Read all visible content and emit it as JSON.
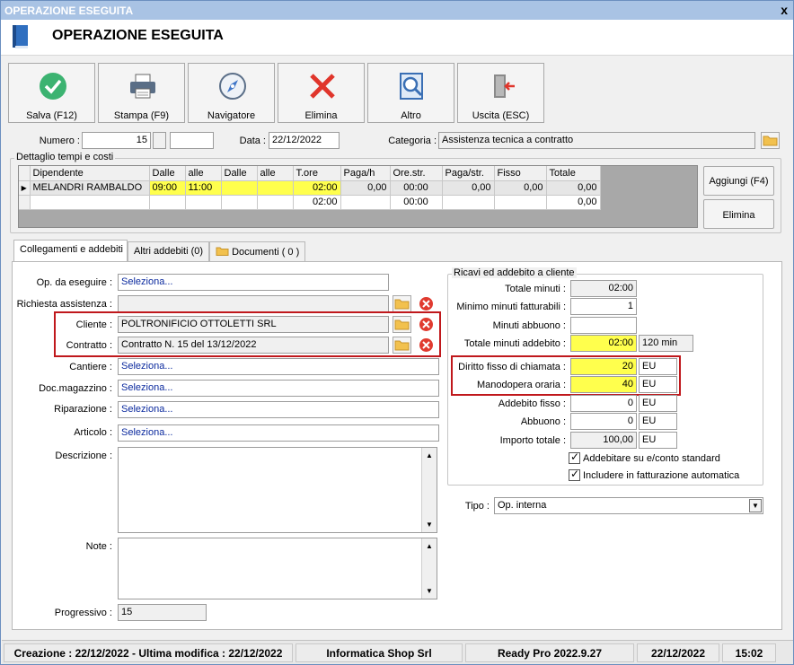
{
  "window": {
    "title": "OPERAZIONE ESEGUITA",
    "close": "x",
    "header_title": "OPERAZIONE ESEGUITA"
  },
  "toolbar": [
    {
      "label": "Salva (F12)",
      "icon": "check-icon"
    },
    {
      "label": "Stampa (F9)",
      "icon": "printer-icon"
    },
    {
      "label": "Navigatore",
      "icon": "compass-icon"
    },
    {
      "label": "Elimina",
      "icon": "delete-x-icon"
    },
    {
      "label": "Altro",
      "icon": "search-doc-icon"
    },
    {
      "label": "Uscita (ESC)",
      "icon": "exit-door-icon"
    }
  ],
  "top": {
    "numero_label": "Numero :",
    "numero_value": "15",
    "numero_suffix": "",
    "data_label": "Data :",
    "data_value": "22/12/2022",
    "categoria_label": "Categoria :",
    "categoria_value": "Assistenza tecnica a contratto"
  },
  "dettaglio": {
    "title": "Dettaglio tempi e costi",
    "columns": [
      "Dipendente",
      "Dalle",
      "alle",
      "Dalle",
      "alle",
      "T.ore",
      "Paga/h",
      "Ore.str.",
      "Paga/str.",
      "Fisso",
      "Totale"
    ],
    "rows": [
      [
        "MELANDRI RAMBALDO",
        "09:00",
        "11:00",
        "",
        "",
        "02:00",
        "0,00",
        "00:00",
        "0,00",
        "0,00",
        "0,00"
      ],
      [
        "",
        "",
        "",
        "",
        "",
        "02:00",
        "",
        "00:00",
        "",
        "",
        "0,00"
      ]
    ],
    "row_indicator": "▶",
    "aggiungi": "Aggiungi (F4)",
    "elimina": "Elimina"
  },
  "tabs": [
    {
      "label": "Collegamenti e addebiti"
    },
    {
      "label": "Altri addebiti (0)"
    },
    {
      "label": "Documenti ( 0 )"
    }
  ],
  "left": {
    "op_label": "Op. da eseguire :",
    "op_value": "Seleziona...",
    "richiesta_label": "Richiesta assistenza :",
    "richiesta_value": "",
    "cliente_label": "Cliente :",
    "cliente_value": "POLTRONIFICIO OTTOLETTI SRL",
    "contratto_label": "Contratto :",
    "contratto_value": "Contratto N. 15 del 13/12/2022",
    "cantiere_label": "Cantiere :",
    "cantiere_value": "Seleziona...",
    "docmag_label": "Doc.magazzino :",
    "docmag_value": "Seleziona...",
    "riparazione_label": "Riparazione :",
    "riparazione_value": "Seleziona...",
    "articolo_label": "Articolo :",
    "articolo_value": "Seleziona...",
    "descrizione_label": "Descrizione :",
    "note_label": "Note :",
    "progressivo_label": "Progressivo :",
    "progressivo_value": "15"
  },
  "ricavi": {
    "title": "Ricavi ed addebito a cliente",
    "totale_minuti_label": "Totale minuti :",
    "totale_minuti": "02:00",
    "minimo_label": "Minimo minuti fatturabili :",
    "minimo": "1",
    "abbuono_min_label": "Minuti abbuono :",
    "abbuono_min": "",
    "tot_addebito_label": "Totale minuti addebito :",
    "tot_addebito": "02:00",
    "tot_addebito_min": "120 min",
    "diritto_label": "Diritto fisso di chiamata :",
    "diritto": "20",
    "diritto_unit": "EU",
    "manodopera_label": "Manodopera oraria :",
    "manodopera": "40",
    "manodopera_unit": "EU",
    "addebito_fisso_label": "Addebito fisso :",
    "addebito_fisso": "0",
    "addebito_fisso_unit": "EU",
    "abbuono_label": "Abbuono :",
    "abbuono": "0",
    "abbuono_unit": "EU",
    "importo_label": "Importo totale :",
    "importo": "100,00",
    "importo_unit": "EU",
    "check1": "Addebitare su e/conto standard",
    "check2": "Includere in fatturazione automatica"
  },
  "tipo": {
    "label": "Tipo :",
    "value": "Op. interna"
  },
  "status": {
    "created": "Creazione : 22/12/2022 - Ultima modifica : 22/12/2022",
    "company": "Informatica Shop Srl",
    "version": "Ready Pro 2022.9.27",
    "date": "22/12/2022",
    "time": "15:02"
  },
  "colors": {
    "highlight": "#ffff4d",
    "box_red": "#c0181c",
    "link_blue": "#0b2a9e"
  }
}
